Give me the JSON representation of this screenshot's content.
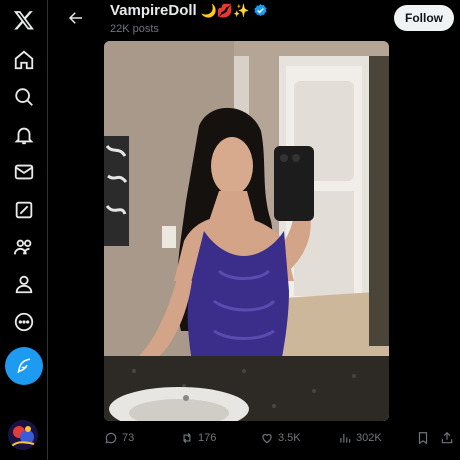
{
  "nav": {
    "items": [
      {
        "icon": "x-logo-icon"
      },
      {
        "icon": "home-icon"
      },
      {
        "icon": "search-icon"
      },
      {
        "icon": "notifications-bell-icon"
      },
      {
        "icon": "messages-envelope-icon"
      },
      {
        "icon": "grok-icon"
      },
      {
        "icon": "communities-icon"
      },
      {
        "icon": "profile-icon"
      },
      {
        "icon": "more-circle-icon"
      }
    ],
    "post_icon": "feather-quill-icon"
  },
  "header": {
    "name": "VampireDoll",
    "emojis": "🌙💋✨",
    "verified": true,
    "posts_count": "22K posts",
    "follow_label": "Follow"
  },
  "actions": {
    "replies": "73",
    "reposts": "176",
    "likes": "3.5K",
    "views": "302K"
  },
  "colors": {
    "accent": "#1d9bf0",
    "background": "#000000",
    "text_secondary": "#71767b"
  }
}
